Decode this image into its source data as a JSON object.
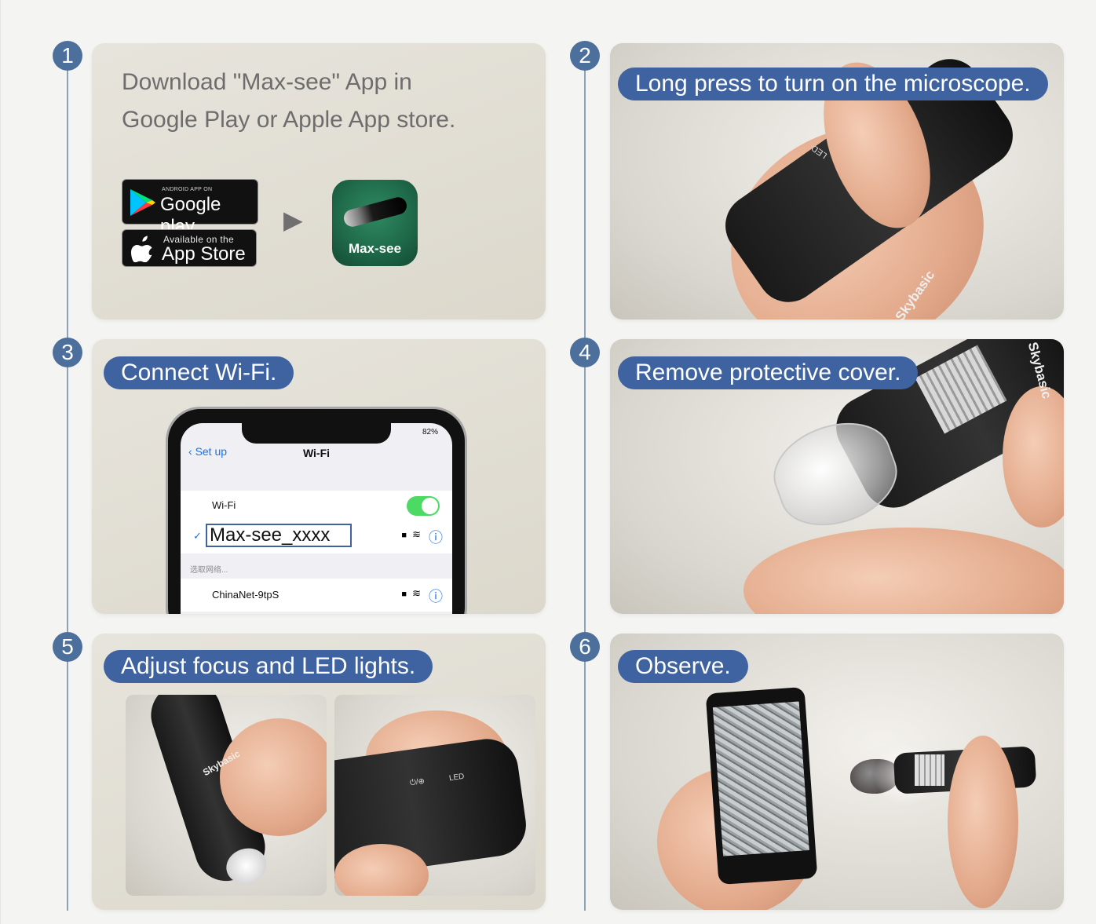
{
  "steps": [
    {
      "number": "1",
      "text_line1": "Download \"Max-see\" App in",
      "text_line2": "Google Play or Apple App store."
    },
    {
      "number": "2",
      "caption": "Long press to turn on the microscope."
    },
    {
      "number": "3",
      "caption": "Connect Wi-Fi."
    },
    {
      "number": "4",
      "caption": "Remove protective cover."
    },
    {
      "number": "5",
      "caption": "Adjust focus and LED lights."
    },
    {
      "number": "6",
      "caption": "Observe."
    }
  ],
  "badges": {
    "google_small": "ANDROID APP ON",
    "google_main": "Google play",
    "apple_small": "Available on the",
    "apple_main": "App Store"
  },
  "app": {
    "name": "Max-see",
    "arrow": "▶"
  },
  "device": {
    "led_label": "LED",
    "brand": "Skybasic",
    "power_label": "⏻/⊕"
  },
  "phone": {
    "status_right": "82%",
    "back_label": "Set up",
    "title": "Wi-Fi",
    "wifi_label": "Wi-Fi",
    "wifi_enabled": true,
    "selected_network": "Max-see_xxxx",
    "check": "✓",
    "section_label": "选取网络...",
    "other_network": "ChinaNet-9tpS",
    "info_icon": "ⓘ"
  },
  "colors": {
    "badge": "#4d6f9c",
    "pill": "#3f62a0",
    "toggle_on": "#4cd964",
    "app_icon": "#1f6a4a"
  }
}
